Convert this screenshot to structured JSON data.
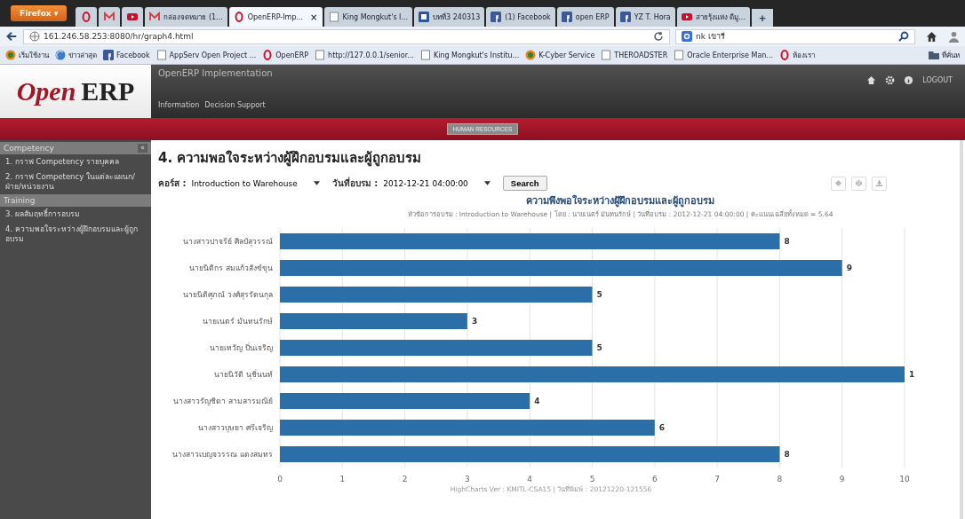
{
  "browser": {
    "menu_button": "Firefox ▾",
    "tabs": [
      {
        "kind": "ring",
        "selected": false
      },
      {
        "kind": "mail",
        "selected": false
      },
      {
        "kind": "video",
        "selected": false
      },
      {
        "kind": "mail",
        "label": "กล่องจดหมาย (1...",
        "selected": false
      },
      {
        "kind": "ring",
        "label": "OpenERP-Imp...",
        "close": "×",
        "selected": true
      },
      {
        "kind": "page",
        "label": "King Mongkut's I...",
        "selected": false
      },
      {
        "kind": "doc",
        "label": "บทที่3 240313",
        "selected": false
      },
      {
        "kind": "social",
        "label": "(1) Facebook",
        "selected": false
      },
      {
        "kind": "social",
        "label": "open ERP",
        "selected": false
      },
      {
        "kind": "social",
        "label": "YZ T. Hora",
        "selected": false
      },
      {
        "kind": "video",
        "label": "สายรุ้งแห่ง ดีมู...",
        "selected": false
      }
    ],
    "new_tab": "+",
    "url": "161.246.58.253:8080/hr/graph4.html",
    "search": "nk เขารี",
    "bookmarks": [
      {
        "kind": "globe",
        "label": "เริ่มใช้งาน"
      },
      {
        "kind": "feed",
        "label": "ข่าวล่าสุด"
      },
      {
        "kind": "social",
        "label": "Facebook"
      },
      {
        "kind": "page",
        "label": "AppServ Open Project ..."
      },
      {
        "kind": "ring",
        "label": "OpenERP"
      },
      {
        "kind": "page",
        "label": "http://127.0.0.1/senior..."
      },
      {
        "kind": "page",
        "label": "King Mongkut's Institu..."
      },
      {
        "kind": "globe",
        "label": "K-Cyber Service"
      },
      {
        "kind": "page",
        "label": "THEROADSTER"
      },
      {
        "kind": "page",
        "label": "Oracle Enterprise Man..."
      },
      {
        "kind": "ring",
        "label": "ห้องเรา"
      },
      {
        "kind": "folder",
        "label": "ที่คั่นห"
      }
    ]
  },
  "app": {
    "logo_left": "Open",
    "logo_right": "ERP",
    "title": "OpenERP Implementation",
    "menu": [
      "Information",
      "Decision Support"
    ],
    "logout": "LOGOUT",
    "module_button": "HUMAN RESOURCES",
    "sidebar": [
      {
        "kind": "header",
        "label": "Competency",
        "collapse": "«"
      },
      {
        "kind": "item",
        "label": "1. กราฟ Competency รายบุคคล"
      },
      {
        "kind": "item",
        "label": "2. กราฟ Competency ในแต่ละแผนก/ฝ่าย/หน่วยงาน"
      },
      {
        "kind": "header",
        "label": "Training"
      },
      {
        "kind": "item",
        "label": "3. ผลสัมฤทธิ์การอบรม"
      },
      {
        "kind": "item",
        "label": "4. ความพอใจระหว่างผู้ฝึกอบรมและผู้ถูกอบรม"
      }
    ],
    "heading": "4. ความพอใจระหว่างผู้ฝึกอบรมและผู้ถูกอบรม",
    "filters": [
      {
        "label": "คอร์ส :",
        "value": "Introduction to Warehouse"
      },
      {
        "label": "วันที่อบรม :",
        "value": "2012-12-21 04:00:00"
      }
    ],
    "search_button": "Search",
    "chart_subtitle": "หัวข้อการอบรม : Introduction to Warehouse | โดย : นายเนตร์ มันทนรักษ์ | วันที่อบรม : 2012-12-21 04:00:00 | คะแนนเฉลี่ยทั้งหมด = 5.64",
    "chart_credits": "HighCharts Ver : KMITL-CSA15 | วันที่พิมพ์ : 20121220-121556",
    "chart_data": {
      "type": "bar",
      "orientation": "horizontal",
      "title": "ความพึงพอใจระหว่างผู้ฝึกอบรมและผู้ถูกอบรม",
      "categories": [
        "นางสาวปาจรีย์ ศิลป์สุวรรณ์",
        "นายนิติกร สมแก้วสังข์ขุน",
        "นายนิติศุภณ์ วงศ์สุรรัตนกุล",
        "นายเนตร์ มันทนรักษ์",
        "นายเทวัญ ปิ่นเจริญ",
        "นายนิวัติ นุชิ่นนท์",
        "นางสาวรัญชิดา สามสารมณีย์",
        "นางสาวบุษยา ศรีเจริญ",
        "นางสาวเบญจวรรณ แดงสมทร"
      ],
      "series": [
        {
          "color": "#2a6fa8",
          "values": [
            8,
            9,
            5,
            3,
            5,
            10,
            4,
            6,
            8
          ]
        }
      ],
      "grid": true,
      "xlim": [
        0,
        10
      ],
      "xticks": [
        0,
        1,
        2,
        3,
        4,
        5,
        6,
        7,
        8,
        9,
        10
      ],
      "value_labels": [
        "8",
        "9",
        "5",
        "3",
        "5",
        "1",
        "4",
        "6",
        "8"
      ]
    }
  }
}
